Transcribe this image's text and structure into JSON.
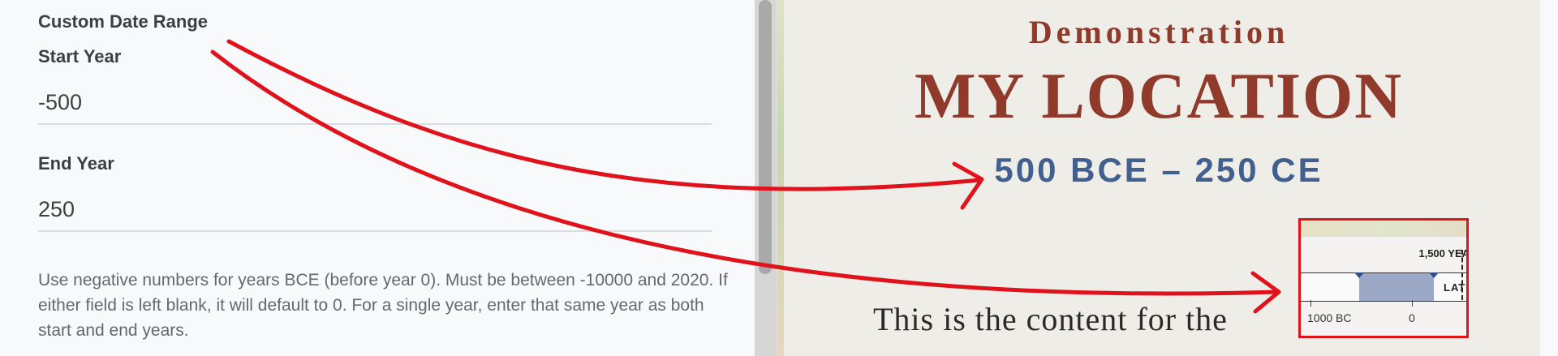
{
  "form": {
    "section_title": "Custom Date Range",
    "start_label": "Start Year",
    "start_value": "-500",
    "end_label": "End Year",
    "end_value": "250",
    "help_text": "Use negative numbers for years BCE (before year 0). Must be between -10000 and 2020. If either field is left blank, it will default to 0. For a single year, enter that same year as both start and end years."
  },
  "poster": {
    "subtitle": "Demonstration",
    "title": "MY LOCATION",
    "date_range": "500 BCE – 250 CE",
    "content_text": "This is the content for the"
  },
  "timeline": {
    "span_label": "1,500 YEA",
    "period_label": "LATE P",
    "tick_left": "1000 BC",
    "tick_zero": "0"
  },
  "colors": {
    "title_red": "#8f3a2a",
    "date_blue": "#42608f",
    "highlight_red": "#e0121b",
    "timeline_fill": "#9ba9c6"
  }
}
